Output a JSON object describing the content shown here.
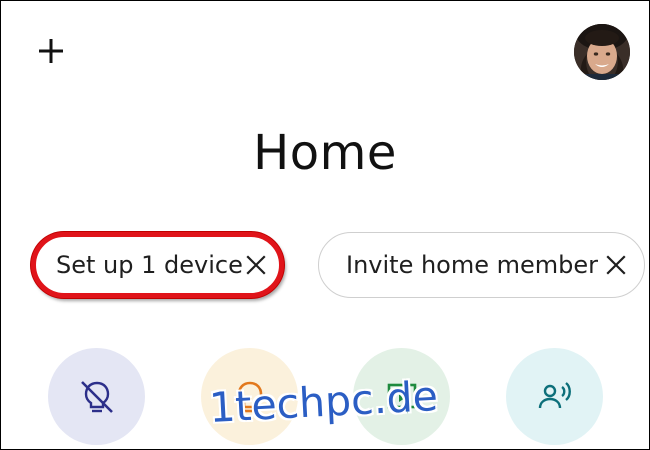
{
  "header": {
    "add_icon": "plus-icon",
    "avatar_icon": "user-avatar"
  },
  "page": {
    "title": "Home"
  },
  "chips": [
    {
      "label": "Set up 1 device",
      "close_icon": "close-icon",
      "highlighted": true
    },
    {
      "label": "Invite home member",
      "close_icon": "close-icon",
      "highlighted": false
    }
  ],
  "shortcuts": [
    {
      "icon": "light-off-icon",
      "bg_color": "#e4e6f4",
      "icon_color": "#2c2f8a"
    },
    {
      "icon": "lightbulb-icon",
      "bg_color": "#fbf1dc",
      "icon_color": "#e2781c"
    },
    {
      "icon": "media-play-icon",
      "bg_color": "#e3f1e6",
      "icon_color": "#1e8a3e"
    },
    {
      "icon": "broadcast-icon",
      "bg_color": "#e1f3f5",
      "icon_color": "#0c6f7a"
    }
  ],
  "highlight_color": "#e0141a",
  "watermark": "1techpc.de"
}
